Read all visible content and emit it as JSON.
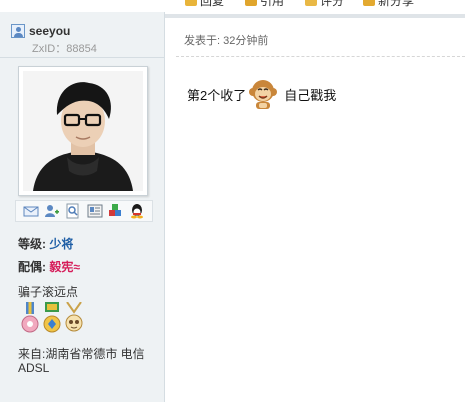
{
  "toolbar": {
    "items": [
      {
        "label": "回复",
        "icon": "reply-icon"
      },
      {
        "label": "引用",
        "icon": "quote-icon"
      },
      {
        "label": "评分",
        "icon": "rate-icon"
      },
      {
        "label": "新分享",
        "icon": "share-icon"
      }
    ]
  },
  "user": {
    "name": "seeyou",
    "zxid": "ZxID：88854",
    "rank_label": "等级:",
    "rank_value": "少将",
    "spouse_label": "配偶:",
    "spouse_value": "毅宪≈",
    "group_text": "骗子滚远点",
    "from_text": "来自:湖南省常德市 电信ADSL"
  },
  "post": {
    "meta": "发表于: 32分钟前",
    "text_before": "第2个收了",
    "text_after": "自己戳我"
  },
  "colors": {
    "sidebar_bg": "#eef2f4",
    "rank_color": "#1f5fa6",
    "spouse_color": "#d61d5a"
  }
}
